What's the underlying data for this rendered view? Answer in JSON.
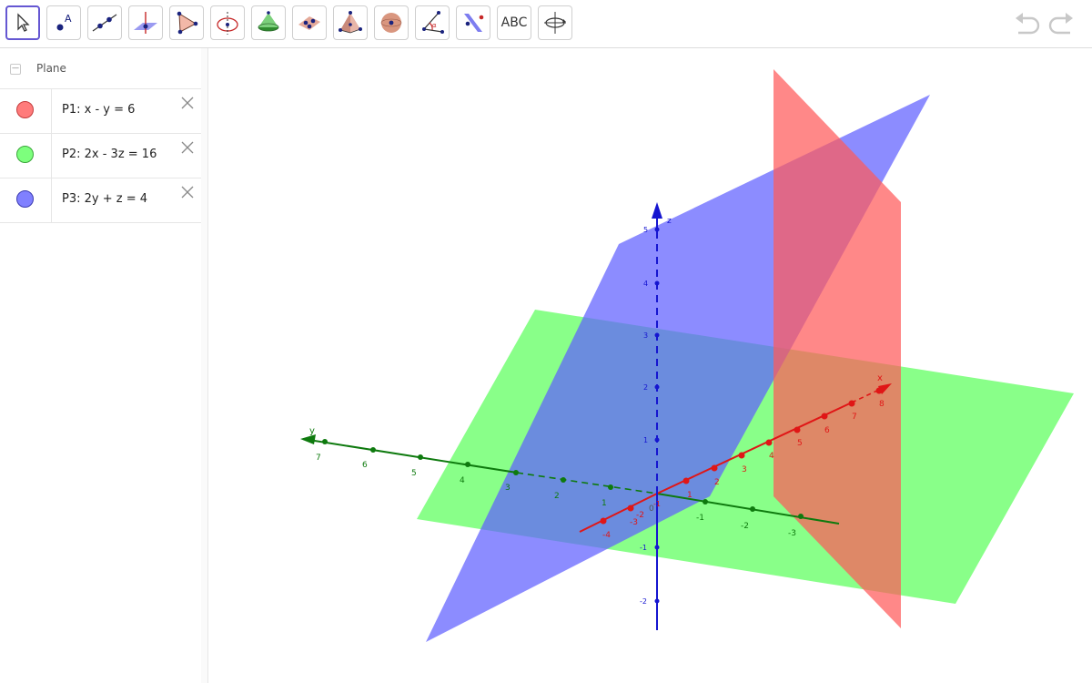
{
  "toolbar": {
    "tools": [
      {
        "name": "move-tool",
        "icon": "cursor-arrow-icon"
      },
      {
        "name": "point-tool",
        "icon": "point-icon"
      },
      {
        "name": "line-tool",
        "icon": "line-through-two-points-icon"
      },
      {
        "name": "perpendicular-line-tool",
        "icon": "perpendicular-line-icon"
      },
      {
        "name": "polygon-tool",
        "icon": "polygon-icon"
      },
      {
        "name": "circle-axis-tool",
        "icon": "circle-with-axis-icon"
      },
      {
        "name": "cone-tool",
        "icon": "cone-icon"
      },
      {
        "name": "plane-through-points-tool",
        "icon": "plane-through-points-icon"
      },
      {
        "name": "pyramid-tool",
        "icon": "pyramid-icon"
      },
      {
        "name": "sphere-tool",
        "icon": "sphere-icon"
      },
      {
        "name": "angle-tool",
        "icon": "angle-icon"
      },
      {
        "name": "reflect-tool",
        "icon": "reflect-about-plane-icon"
      },
      {
        "name": "text-tool",
        "icon": "text-icon",
        "label": "ABC"
      },
      {
        "name": "rotate-view-tool",
        "icon": "rotate-3d-view-icon"
      }
    ],
    "undo_icon": "undo-icon",
    "redo_icon": "redo-icon"
  },
  "algebra": {
    "group_label": "Plane",
    "collapse_symbol": "—",
    "items": [
      {
        "label": "P1: x - y = 6",
        "color": "#ff7b7b"
      },
      {
        "label": "P2: 2x - 3z = 16",
        "color": "#7dff7d"
      },
      {
        "label": "P3: 2y + z = 4",
        "color": "#8080ff"
      }
    ]
  },
  "graphics": {
    "axes": {
      "x": {
        "label": "x",
        "color": "#e01616",
        "ticks": [
          "-4",
          "-3",
          "-2",
          "-1",
          "1",
          "2",
          "3",
          "4",
          "5",
          "6",
          "7",
          "8"
        ]
      },
      "y": {
        "label": "y",
        "color": "#0e7a0e",
        "ticks": [
          "7",
          "6",
          "5",
          "4",
          "3",
          "2",
          "1",
          "-1",
          "-2",
          "-3"
        ]
      },
      "z": {
        "label": "z",
        "color": "#1515d0",
        "ticks": [
          "5",
          "4",
          "3",
          "2",
          "1",
          "-1",
          "-2"
        ]
      }
    },
    "origin_label": "0",
    "planes": [
      {
        "name": "P1",
        "color": "#ff5a5a"
      },
      {
        "name": "P2",
        "color": "#5cff5c"
      },
      {
        "name": "P3",
        "color": "#6060ff"
      }
    ]
  }
}
